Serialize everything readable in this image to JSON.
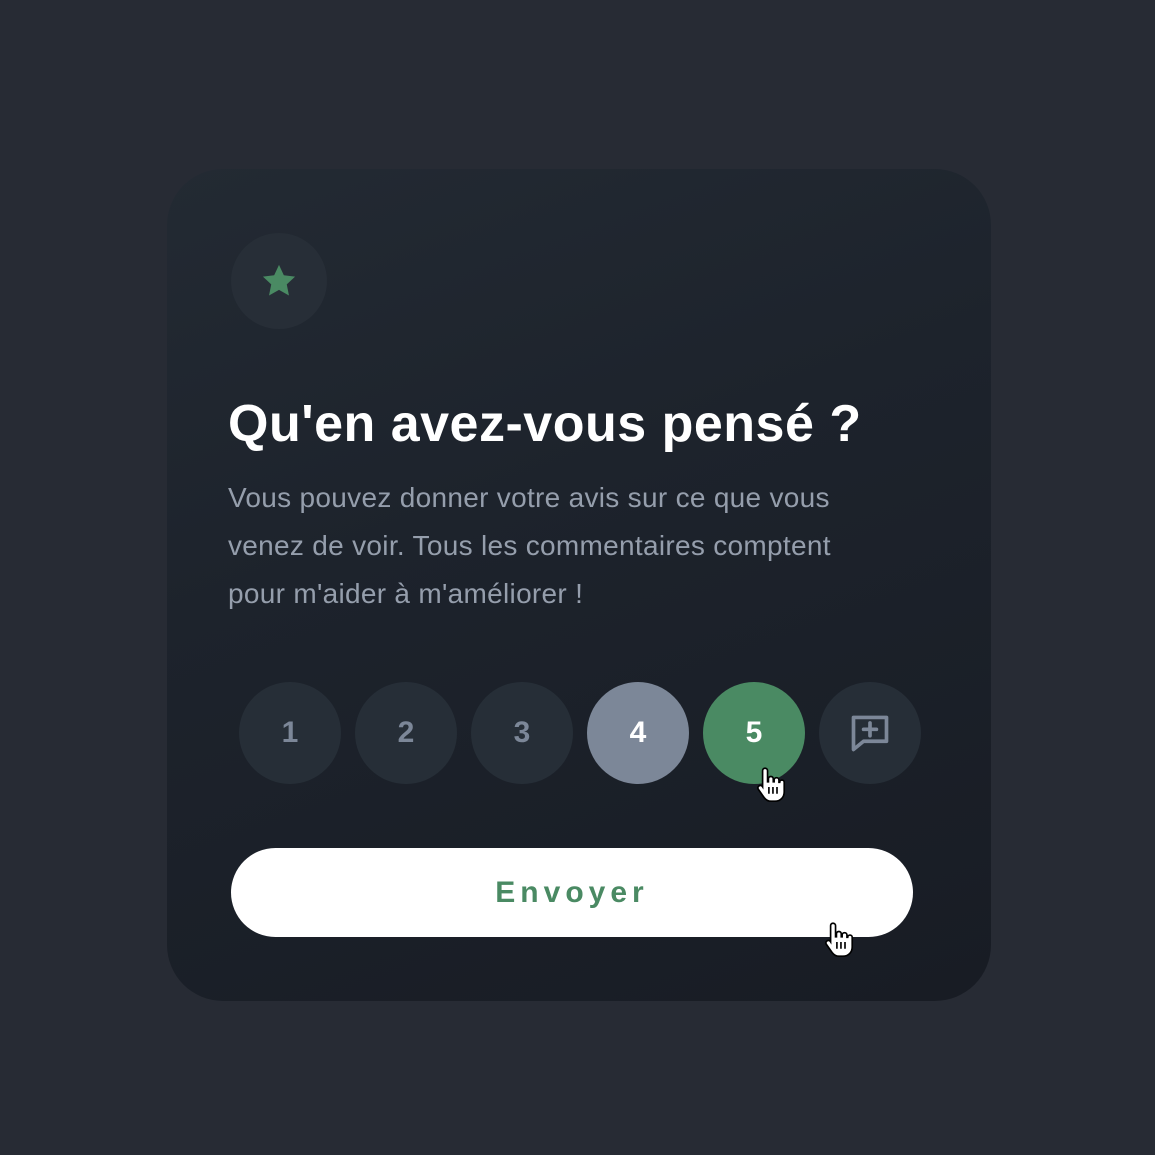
{
  "card": {
    "title": "Qu'en avez-vous pensé ?",
    "description_lines": [
      "Vous pouvez donner votre avis sur ce que vous",
      "venez de voir.  Tous les commentaires comptent",
      "pour m'aider à m'améliorer !"
    ],
    "badge_icon": "star-icon"
  },
  "rating": {
    "options": [
      "1",
      "2",
      "3",
      "4",
      "5"
    ],
    "selected": "5",
    "extra_icon": "comment-plus-icon"
  },
  "submit": {
    "label": "Envoyer"
  },
  "colors": {
    "background": "#272b34",
    "card": "#1d232c",
    "accent": "#4a8a63",
    "muted": "#7c8798",
    "text_secondary": "#959eac"
  }
}
